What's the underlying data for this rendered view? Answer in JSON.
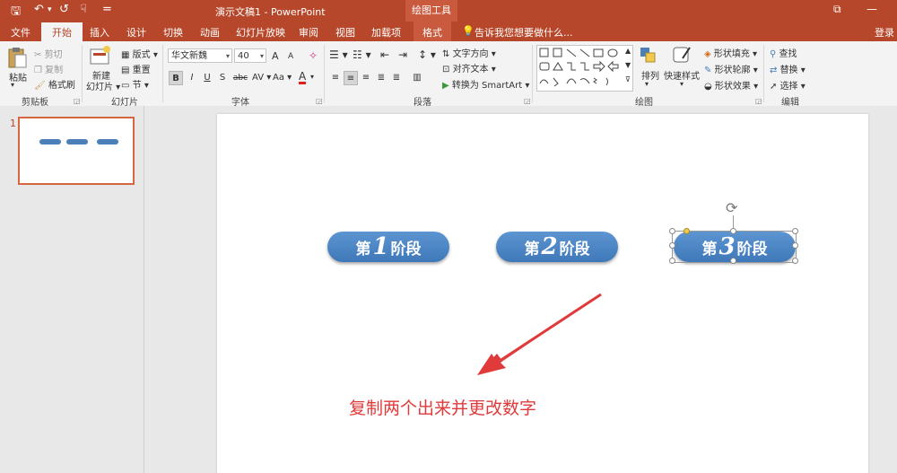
{
  "titlebar": {
    "title": "演示文稿1 - PowerPoint",
    "context_group": "绘图工具",
    "quick_access": {
      "save": "🖫",
      "undo": "↶",
      "undo_dd": "▾",
      "redo": "↺",
      "touch": "☟",
      "customize": "="
    },
    "window": {
      "restore": "⧉",
      "minimize": "—"
    }
  },
  "tabs": [
    "文件",
    "开始",
    "插入",
    "设计",
    "切换",
    "动画",
    "幻灯片放映",
    "审阅",
    "视图",
    "加载项",
    "格式"
  ],
  "tell_me": "告诉我您想要做什么...",
  "signin": "登录",
  "clipboard": {
    "paste": "粘贴",
    "cut": "剪切",
    "copy": "复制",
    "format_painter": "格式刷",
    "label": "剪贴板"
  },
  "slides_group": {
    "new_slide_line1": "新建",
    "new_slide_line2": "幻灯片",
    "layout": "版式",
    "reset": "重置",
    "section": "节",
    "label": "幻灯片"
  },
  "font_group": {
    "font_name": "华文新魏",
    "font_size": "40",
    "grow": "A",
    "shrink": "A",
    "clear": "✧",
    "bold": "B",
    "italic": "I",
    "underline": "U",
    "shadow": "S",
    "strike": "abc",
    "spacing": "AV",
    "case": "Aa",
    "color": "A",
    "label": "字体"
  },
  "paragraph_group": {
    "text_direction": "文字方向",
    "align_text": "对齐文本",
    "smartart": "转换为 SmartArt",
    "label": "段落"
  },
  "drawing_group": {
    "arrange": "排列",
    "quick_styles": "快速样式",
    "fill": "形状填充",
    "outline": "形状轮廓",
    "effects": "形状效果",
    "label": "绘图"
  },
  "editing_group": {
    "find": "查找",
    "replace": "替换",
    "select": "选择",
    "label": "编辑"
  },
  "slide_thumb": {
    "number": "1"
  },
  "slide": {
    "stages": [
      {
        "prefix": "第",
        "num": "1",
        "suffix": "阶段"
      },
      {
        "prefix": "第",
        "num": "2",
        "suffix": "阶段"
      },
      {
        "prefix": "第",
        "num": "3",
        "suffix": "阶段"
      }
    ],
    "annotation": "复制两个出来并更改数字"
  },
  "colors": {
    "accent": "#b7472a",
    "stage_fill": "#4a86c6",
    "annotation": "#e03a3a"
  }
}
